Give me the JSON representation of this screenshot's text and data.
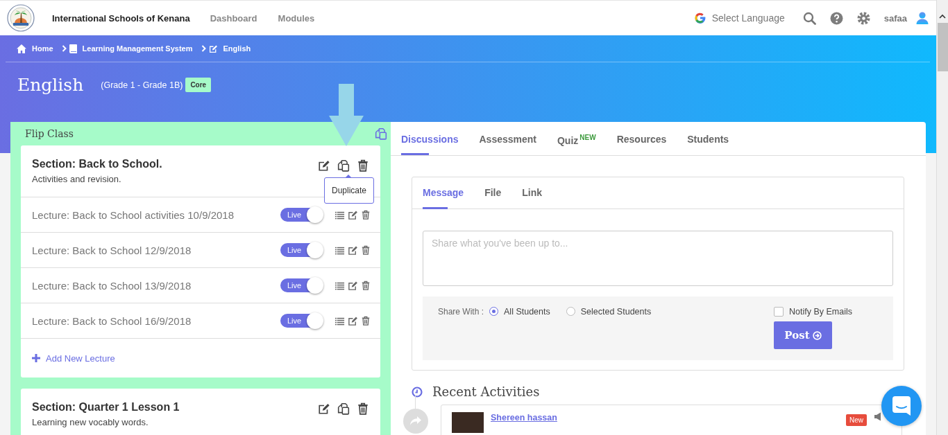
{
  "header": {
    "school_name": "International Schools of Kenana",
    "nav": [
      {
        "label": "Dashboard"
      },
      {
        "label": "Modules"
      }
    ],
    "language": "Select Language",
    "user": "safaa"
  },
  "breadcrumb": [
    {
      "label": "Home"
    },
    {
      "label": "Learning Management System"
    },
    {
      "label": "English"
    }
  ],
  "course": {
    "title": "English",
    "grade": "(Grade 1 - Grade 1B)",
    "badge": "Core"
  },
  "flip_class": {
    "title": "Flip Class",
    "sections": [
      {
        "title": "Section: Back to School.",
        "description": "Activities and revision.",
        "tooltip": "Duplicate",
        "add_label": "Add New Lecture",
        "lectures": [
          {
            "title": "Lecture: Back to School activities 10/9/2018",
            "live_label": "Live",
            "live": true
          },
          {
            "title": "Lecture: Back to School 12/9/2018",
            "live_label": "Live",
            "live": true
          },
          {
            "title": "Lecture: Back to School 13/9/2018",
            "live_label": "Live",
            "live": true
          },
          {
            "title": "Lecture: Back to School 16/9/2018",
            "live_label": "Live",
            "live": true
          }
        ]
      },
      {
        "title": "Section: Quarter 1 Lesson 1",
        "description": "Learning new vocably words."
      }
    ]
  },
  "tabs": [
    {
      "label": "Discussions",
      "selected": true
    },
    {
      "label": "Assessment",
      "selected": false
    },
    {
      "label": "Quiz",
      "badge": "NEW",
      "selected": false
    },
    {
      "label": "Resources",
      "selected": false
    },
    {
      "label": "Students",
      "selected": false
    }
  ],
  "composer": {
    "tabs": [
      {
        "label": "Message",
        "selected": true
      },
      {
        "label": "File",
        "selected": false
      },
      {
        "label": "Link",
        "selected": false
      }
    ],
    "placeholder": "Share what you've been up to...",
    "share_label": "Share With :",
    "share_options": [
      {
        "label": "All Students",
        "selected": true
      },
      {
        "label": "Selected Students",
        "selected": false
      }
    ],
    "notify": {
      "label": "Notify By Emails",
      "checked": false
    },
    "post_button": "Post"
  },
  "recent_activities": {
    "title": "Recent Activities",
    "items": [
      {
        "author": "Shereen hassan",
        "badge": "New"
      }
    ]
  }
}
